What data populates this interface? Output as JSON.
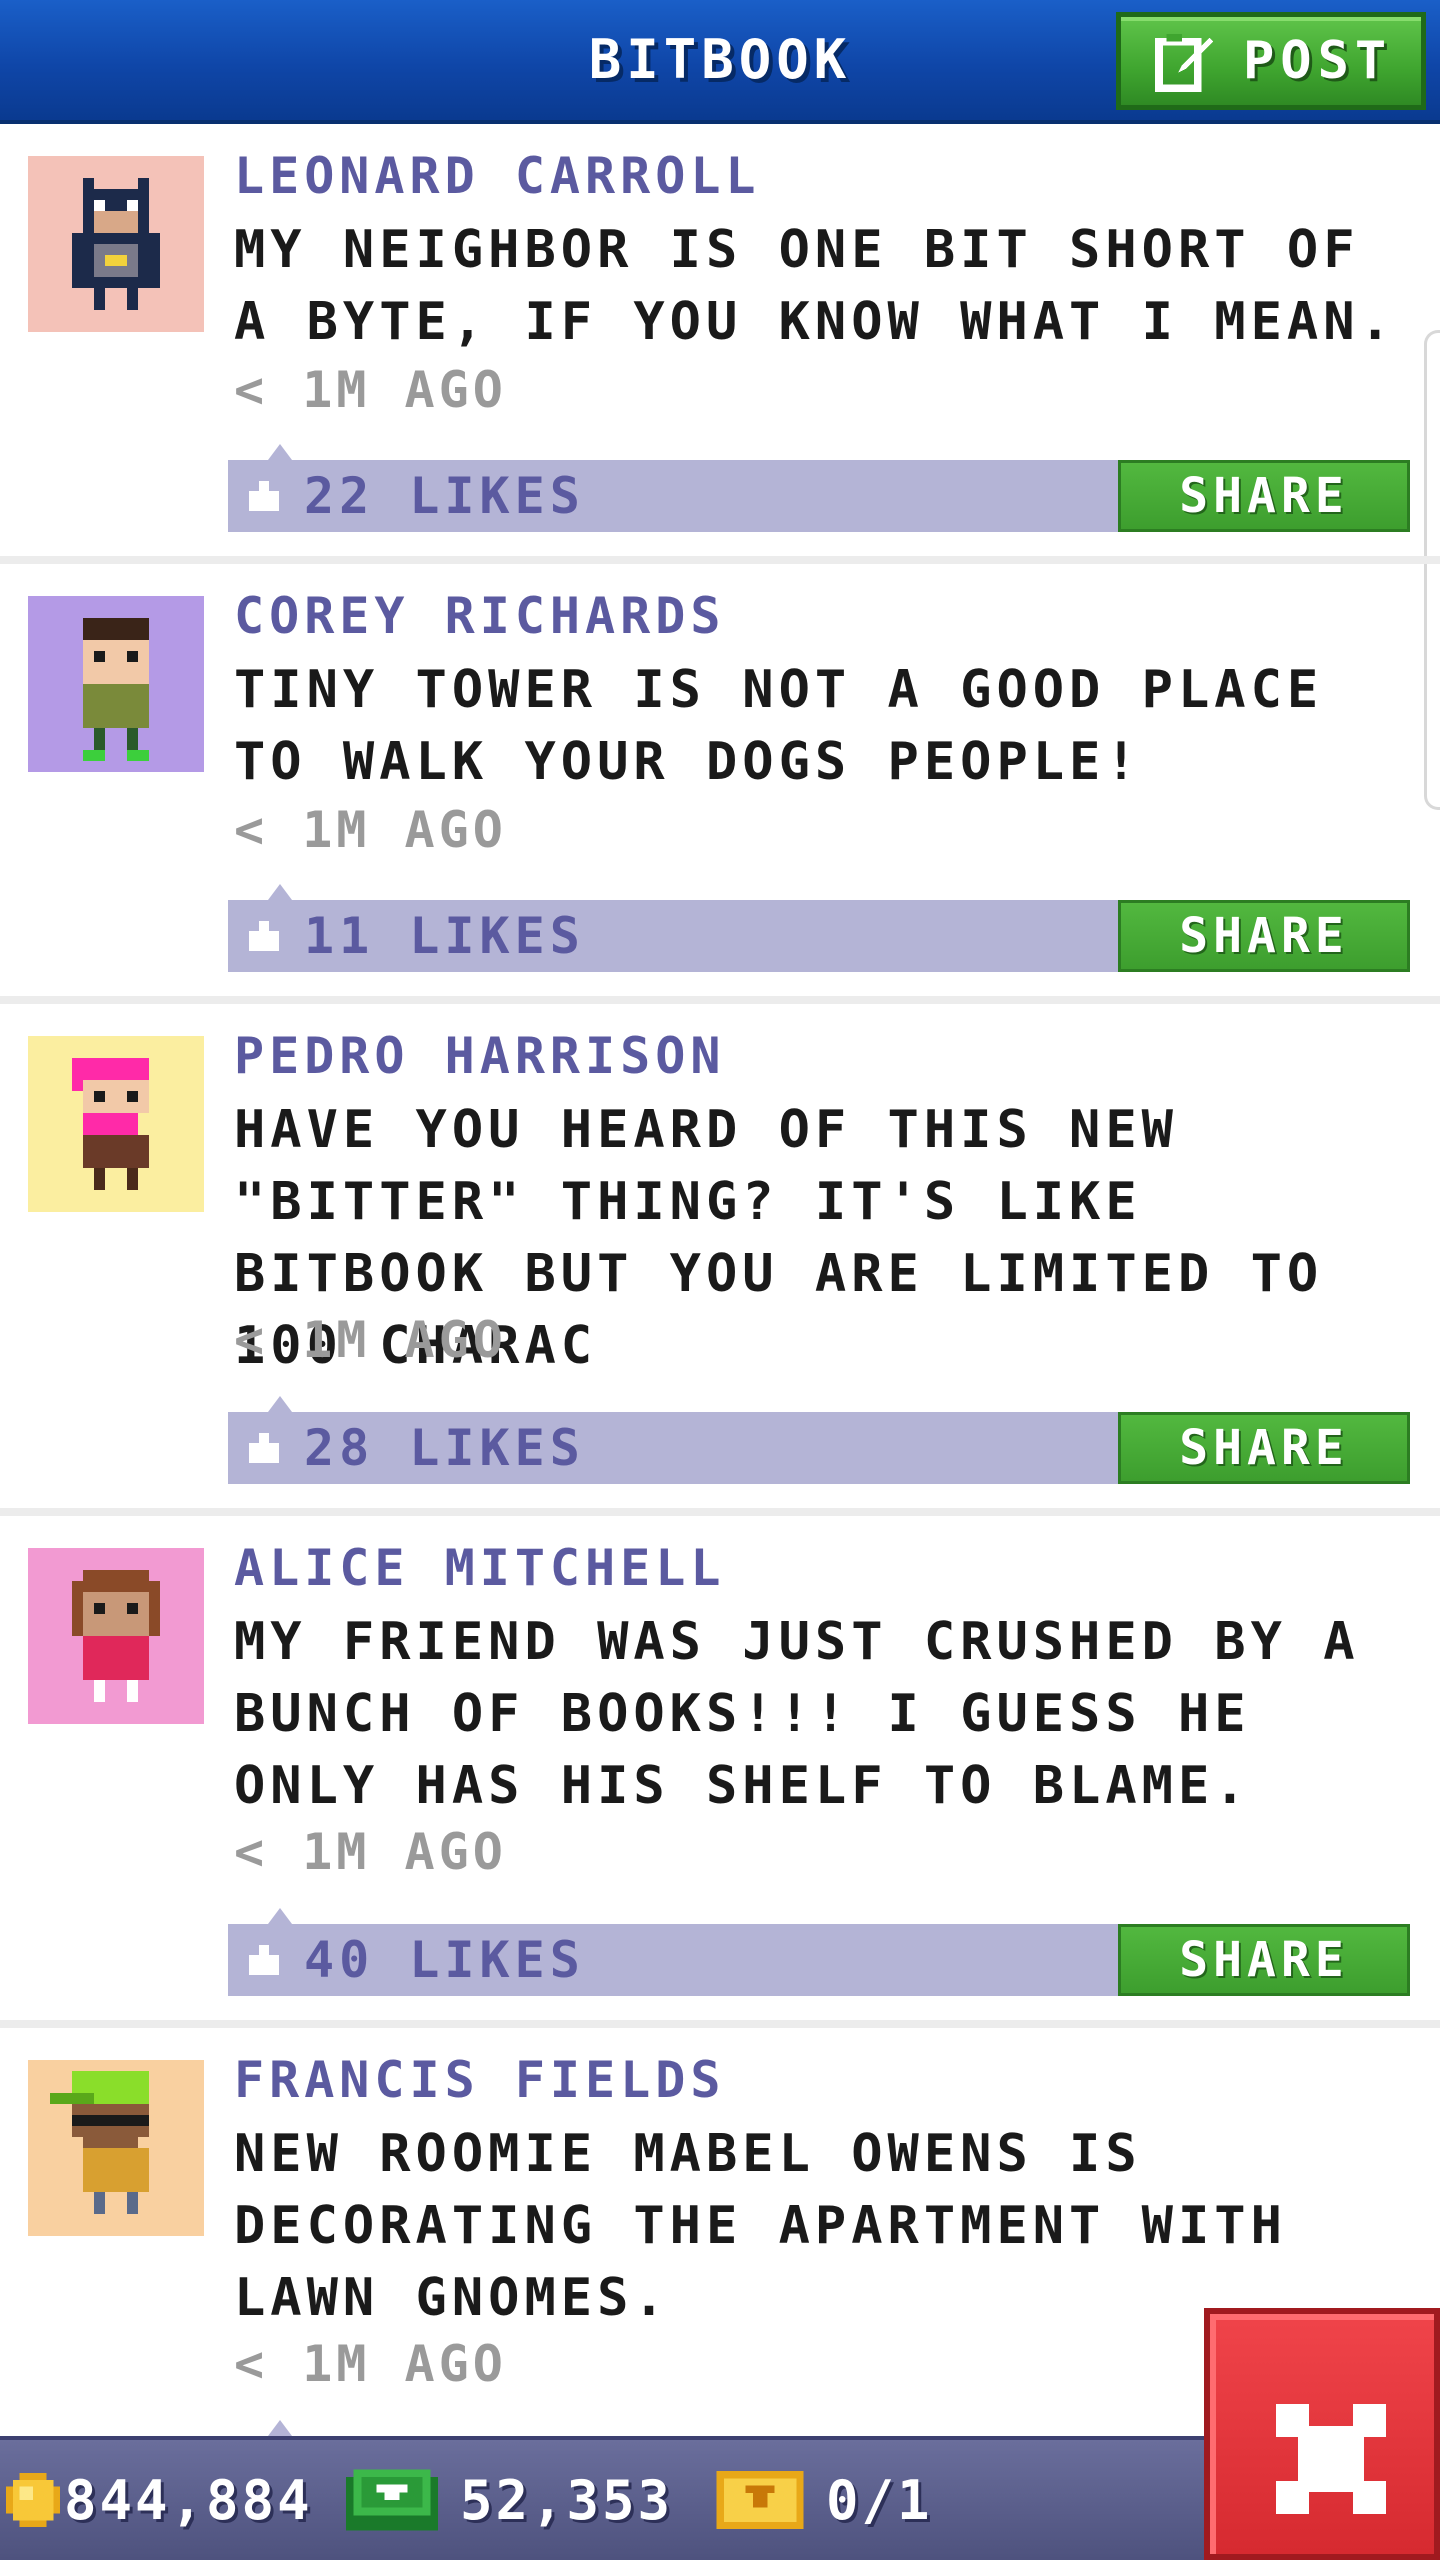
{
  "header": {
    "title": "BITBOOK",
    "post_label": "POST"
  },
  "feed": {
    "posts": [
      {
        "author": "LEONARD CARROLL",
        "message": "MY NEIGHBOR IS ONE BIT SHORT OF A BYTE, IF YOU KNOW WHAT I MEAN.",
        "time": "< 1M AGO",
        "likes": "22 LIKES",
        "share_label": "SHARE",
        "avatar": {
          "icon": "batman-costume-avatar-icon",
          "bg": "#f4c2b8"
        }
      },
      {
        "author": "COREY RICHARDS",
        "message": "TINY TOWER IS NOT A GOOD PLACE TO WALK YOUR DOGS PEOPLE!",
        "time": "< 1M AGO",
        "likes": "11 LIKES",
        "share_label": "SHARE",
        "avatar": {
          "icon": "bitizen-avatar-icon",
          "bg": "#b49ae6"
        }
      },
      {
        "author": "PEDRO HARRISON",
        "message": "HAVE YOU HEARD OF THIS NEW \"BITTER\" THING? IT'S LIKE BITBOOK BUT YOU ARE LIMITED TO 100 CHARAC",
        "time": "< 1M AGO",
        "likes": "28 LIKES",
        "share_label": "SHARE",
        "avatar": {
          "icon": "pink-hair-bitizen-avatar-icon",
          "bg": "#fbeea0"
        }
      },
      {
        "author": "ALICE MITCHELL",
        "message": "MY FRIEND WAS JUST CRUSHED BY A BUNCH OF BOOKS!!! I GUESS HE ONLY HAS HIS SHELF TO BLAME.",
        "time": "< 1M AGO",
        "likes": "40 LIKES",
        "share_label": "SHARE",
        "avatar": {
          "icon": "bitizen-avatar-icon",
          "bg": "#f29ad2"
        }
      },
      {
        "author": "FRANCIS FIELDS",
        "message": "NEW ROOMIE MABEL OWENS IS DECORATING THE APARTMENT WITH LAWN GNOMES.",
        "time": "< 1M AGO",
        "avatar": {
          "icon": "green-cap-bitizen-avatar-icon",
          "bg": "#f9d0a0"
        }
      }
    ]
  },
  "footer": {
    "coins": "844,884",
    "bux": "52,353",
    "tickets": "0/1"
  },
  "colors": {
    "header_blue": "#0f46a8",
    "post_green": "#3fa52f",
    "author_purple": "#5b5aa0",
    "likes_bar": "#b4b4d6",
    "close_red": "#d62a30"
  }
}
